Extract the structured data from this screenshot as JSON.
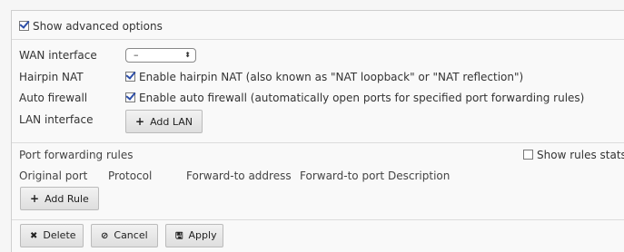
{
  "advanced": {
    "label": "Show advanced options",
    "checked": true
  },
  "wan": {
    "label": "WAN interface",
    "selected": "–"
  },
  "hairpin": {
    "label": "Hairpin NAT",
    "option": "Enable hairpin NAT (also known as \"NAT loopback\" or \"NAT reflection\")",
    "checked": true
  },
  "firewall": {
    "label": "Auto firewall",
    "option": "Enable auto firewall (automatically open ports for specified port forwarding rules)",
    "checked": true
  },
  "lan": {
    "label": "LAN interface",
    "add_button": "Add LAN"
  },
  "rules": {
    "title": "Port forwarding rules",
    "show_stats_label": "Show rules stats",
    "show_stats_checked": false,
    "columns": [
      "Original port",
      "Protocol",
      "Forward-to address",
      "Forward-to port",
      "Description"
    ],
    "add_button": "Add Rule"
  },
  "actions": {
    "delete": "Delete",
    "cancel": "Cancel",
    "apply": "Apply"
  },
  "icons": {
    "plus": "+",
    "delete": "✖",
    "cancel": "⊘",
    "apply": "🖫"
  },
  "colors": {
    "check": "#2d4ea8",
    "separator": "#dcdcdc"
  }
}
